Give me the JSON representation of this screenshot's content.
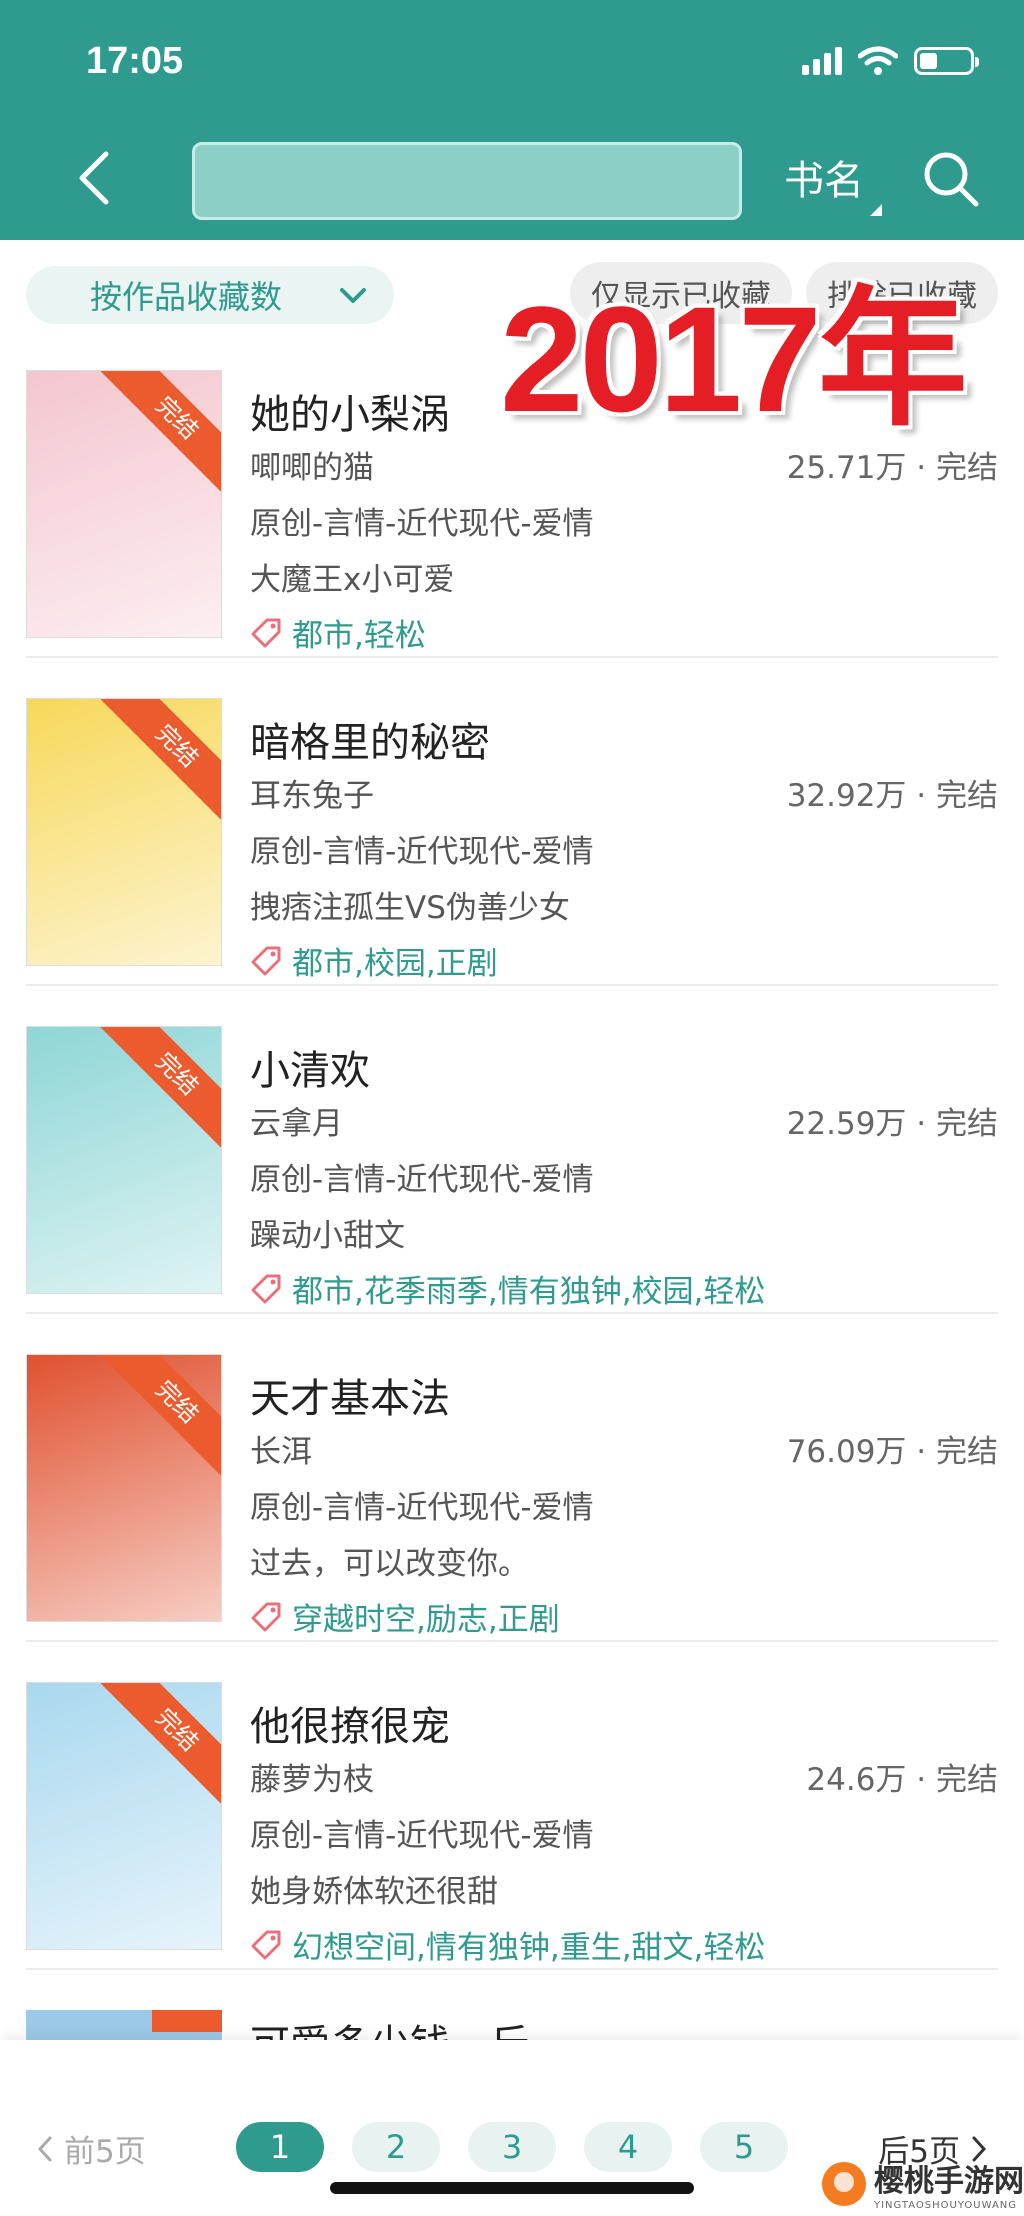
{
  "status_bar": {
    "time": "17:05",
    "battery_level": 0.35
  },
  "search": {
    "placeholder": "",
    "field_label": "书名"
  },
  "filters": {
    "sort_label": "按作品收藏数",
    "chip_show_collected": "仅显示已收藏",
    "chip_exclude_collected": "排除已收藏"
  },
  "overlay_text": "2017年",
  "books": [
    {
      "title": "她的小梨涡",
      "author": "唧唧的猫",
      "stats": "25.71万 · 完结",
      "category": "原创-言情-近代现代-爱情",
      "tagline": "大魔王x小可爱",
      "tags": "都市,轻松",
      "badge": "完结",
      "cover_color": "#f4c6cf"
    },
    {
      "title": "暗格里的秘密",
      "author": "耳东兔子",
      "stats": "32.92万 · 完结",
      "category": "原创-言情-近代现代-爱情",
      "tagline": "拽痞注孤生VS伪善少女",
      "tags": "都市,校园,正剧",
      "badge": "完结",
      "cover_color": "#f7d85a"
    },
    {
      "title": "小清欢",
      "author": "云拿月",
      "stats": "22.59万 · 完结",
      "category": "原创-言情-近代现代-爱情",
      "tagline": "躁动小甜文",
      "tags": "都市,花季雨季,情有独钟,校园,轻松",
      "badge": "完结",
      "cover_color": "#8fd6d6"
    },
    {
      "title": "天才基本法",
      "author": "长洱",
      "stats": "76.09万 · 完结",
      "category": "原创-言情-近代现代-爱情",
      "tagline": "过去，可以改变你。",
      "tags": "穿越时空,励志,正剧",
      "badge": "完结",
      "cover_color": "#e0512f"
    },
    {
      "title": "他很撩很宠",
      "author": "藤萝为枝",
      "stats": "24.6万 · 完结",
      "category": "原创-言情-近代现代-爱情",
      "tagline": "她身娇体软还很甜",
      "tags": "幻想空间,情有独钟,重生,甜文,轻松",
      "badge": "完结",
      "cover_color": "#a9d8ef"
    }
  ],
  "partial_book": {
    "title": "可爱多少钱一斤"
  },
  "pagination": {
    "prev_label": "前5页",
    "next_label": "后5页",
    "pages": [
      "1",
      "2",
      "3",
      "4",
      "5"
    ],
    "active_page": "1"
  },
  "watermark": {
    "cn": "樱桃手游网",
    "en": "YINGTAOSHOUYOUWANG"
  },
  "colors": {
    "primary": "#2e9b8e",
    "badge": "#ec5b2e",
    "overlay": "#e51d24"
  }
}
